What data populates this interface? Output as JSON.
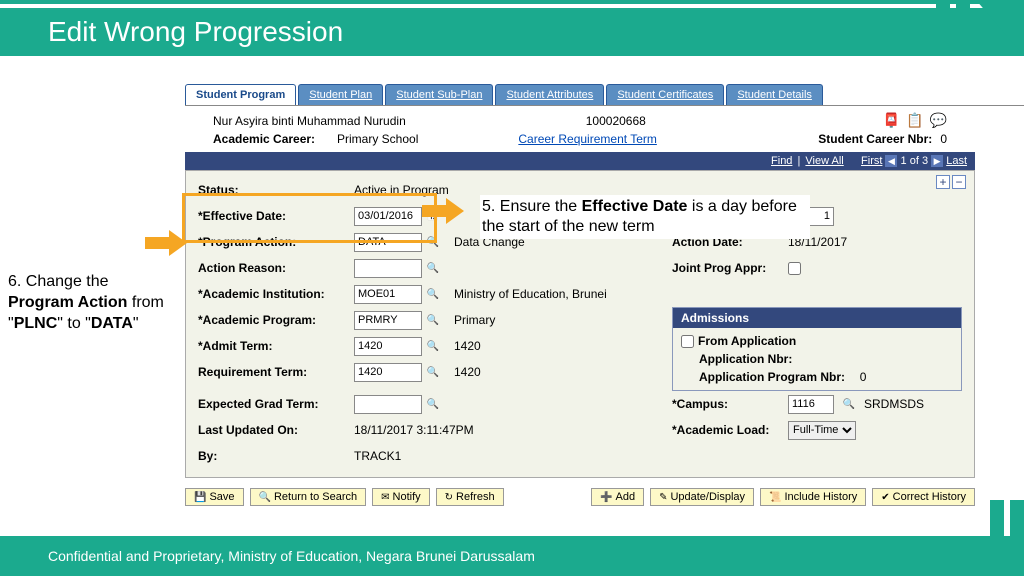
{
  "header": {
    "title": "Edit Wrong Progression"
  },
  "tabs": {
    "t0": "Student Program",
    "t1": "Student Plan",
    "t2": "Student Sub-Plan",
    "t3": "Student Attributes",
    "t4": "Student Certificates",
    "t5": "Student Details"
  },
  "student": {
    "name": "Nur Asyira binti Muhammad Nurudin",
    "id": "100020668",
    "career_label": "Academic Career:",
    "career_value": "Primary School",
    "req_link": "Career Requirement Term",
    "snbr_label": "Student Career Nbr:",
    "snbr_value": "0"
  },
  "nav": {
    "find": "Find",
    "viewall": "View All",
    "first": "First",
    "pos": "1 of 3",
    "last": "Last"
  },
  "form": {
    "status_label": "Status:",
    "status_value": "Active in Program",
    "eff_date_label": "*Effective Date:",
    "eff_date_value": "03/01/2016",
    "seq_value": "1",
    "prog_action_label": "*Program Action:",
    "prog_action_value": "DATA",
    "prog_action_desc": "Data Change",
    "action_date_label": "Action Date:",
    "action_date_value": "18/11/2017",
    "action_reason_label": "Action Reason:",
    "joint_label": "Joint Prog Appr:",
    "inst_label": "*Academic Institution:",
    "inst_value": "MOE01",
    "inst_desc": "Ministry of Education, Brunei",
    "prog_label": "*Academic Program:",
    "prog_value": "PRMRY",
    "prog_desc": "Primary",
    "admit_label": "*Admit Term:",
    "admit_value": "1420",
    "admit_desc": "1420",
    "req_label": "Requirement Term:",
    "req_value": "1420",
    "req_desc": "1420",
    "grad_label": "Expected Grad Term:",
    "updated_label": "Last Updated On:",
    "updated_value": "18/11/2017 3:11:47PM",
    "by_label": "By:",
    "by_value": "TRACK1",
    "campus_label": "*Campus:",
    "campus_value": "1116",
    "campus_desc": "SRDMSDS",
    "load_label": "*Academic Load:",
    "load_value": "Full-Time"
  },
  "admissions": {
    "title": "Admissions",
    "from_app": "From Application",
    "app_nbr": "Application Nbr:",
    "app_prog_nbr": "Application Program Nbr:",
    "app_prog_val": "0"
  },
  "buttons": {
    "save": "Save",
    "return": "Return to Search",
    "notify": "Notify",
    "refresh": "Refresh",
    "add": "Add",
    "update": "Update/Display",
    "include": "Include History",
    "correct": "Correct History"
  },
  "callouts": {
    "c5a": "5. Ensure the ",
    "c5b": "Effective Date",
    "c5c": " is a day before the start of the new term",
    "c6a": "6. Change the ",
    "c6b": "Program Action",
    "c6c": " from \"",
    "c6d": "PLNC",
    "c6e": "\" to \"",
    "c6f": "DATA",
    "c6g": "\""
  },
  "footer": {
    "text": "Confidential and Proprietary, Ministry of Education, Negara Brunei Darussalam"
  }
}
